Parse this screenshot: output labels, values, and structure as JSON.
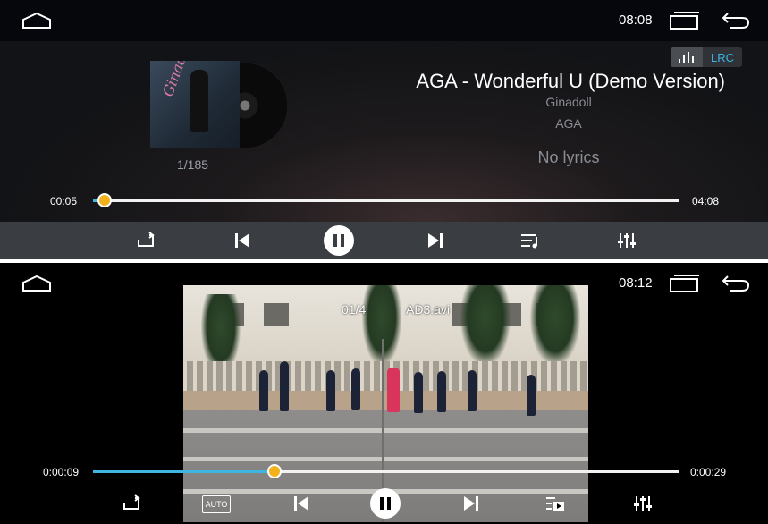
{
  "music_player": {
    "status": {
      "time": "08:08"
    },
    "lrc_button": {
      "label": "LRC"
    },
    "album": {
      "cover_text": "Ginadoll"
    },
    "track_counter": "1/185",
    "song": {
      "title": "AGA - Wonderful U (Demo Version)",
      "album": "Ginadoll",
      "artist": "AGA",
      "lyrics_status": "No lyrics"
    },
    "progress": {
      "elapsed": "00:05",
      "total": "04:08",
      "fraction": 0.02
    },
    "controls": [
      "repeat",
      "previous",
      "pause",
      "next",
      "playlist",
      "equalizer"
    ],
    "accent_color": "#3fb6e2",
    "knob_color": "#f4b21a"
  },
  "video_player": {
    "status": {
      "time": "08:12"
    },
    "video_info": {
      "index": "01/4",
      "filename": "AD3.avi"
    },
    "progress": {
      "elapsed": "0:00:09",
      "total": "0:00:29",
      "fraction": 0.31
    },
    "controls": {
      "auto_label": "AUTO",
      "items": [
        "repeat",
        "auto",
        "previous",
        "pause",
        "next",
        "playlist",
        "equalizer"
      ]
    }
  }
}
